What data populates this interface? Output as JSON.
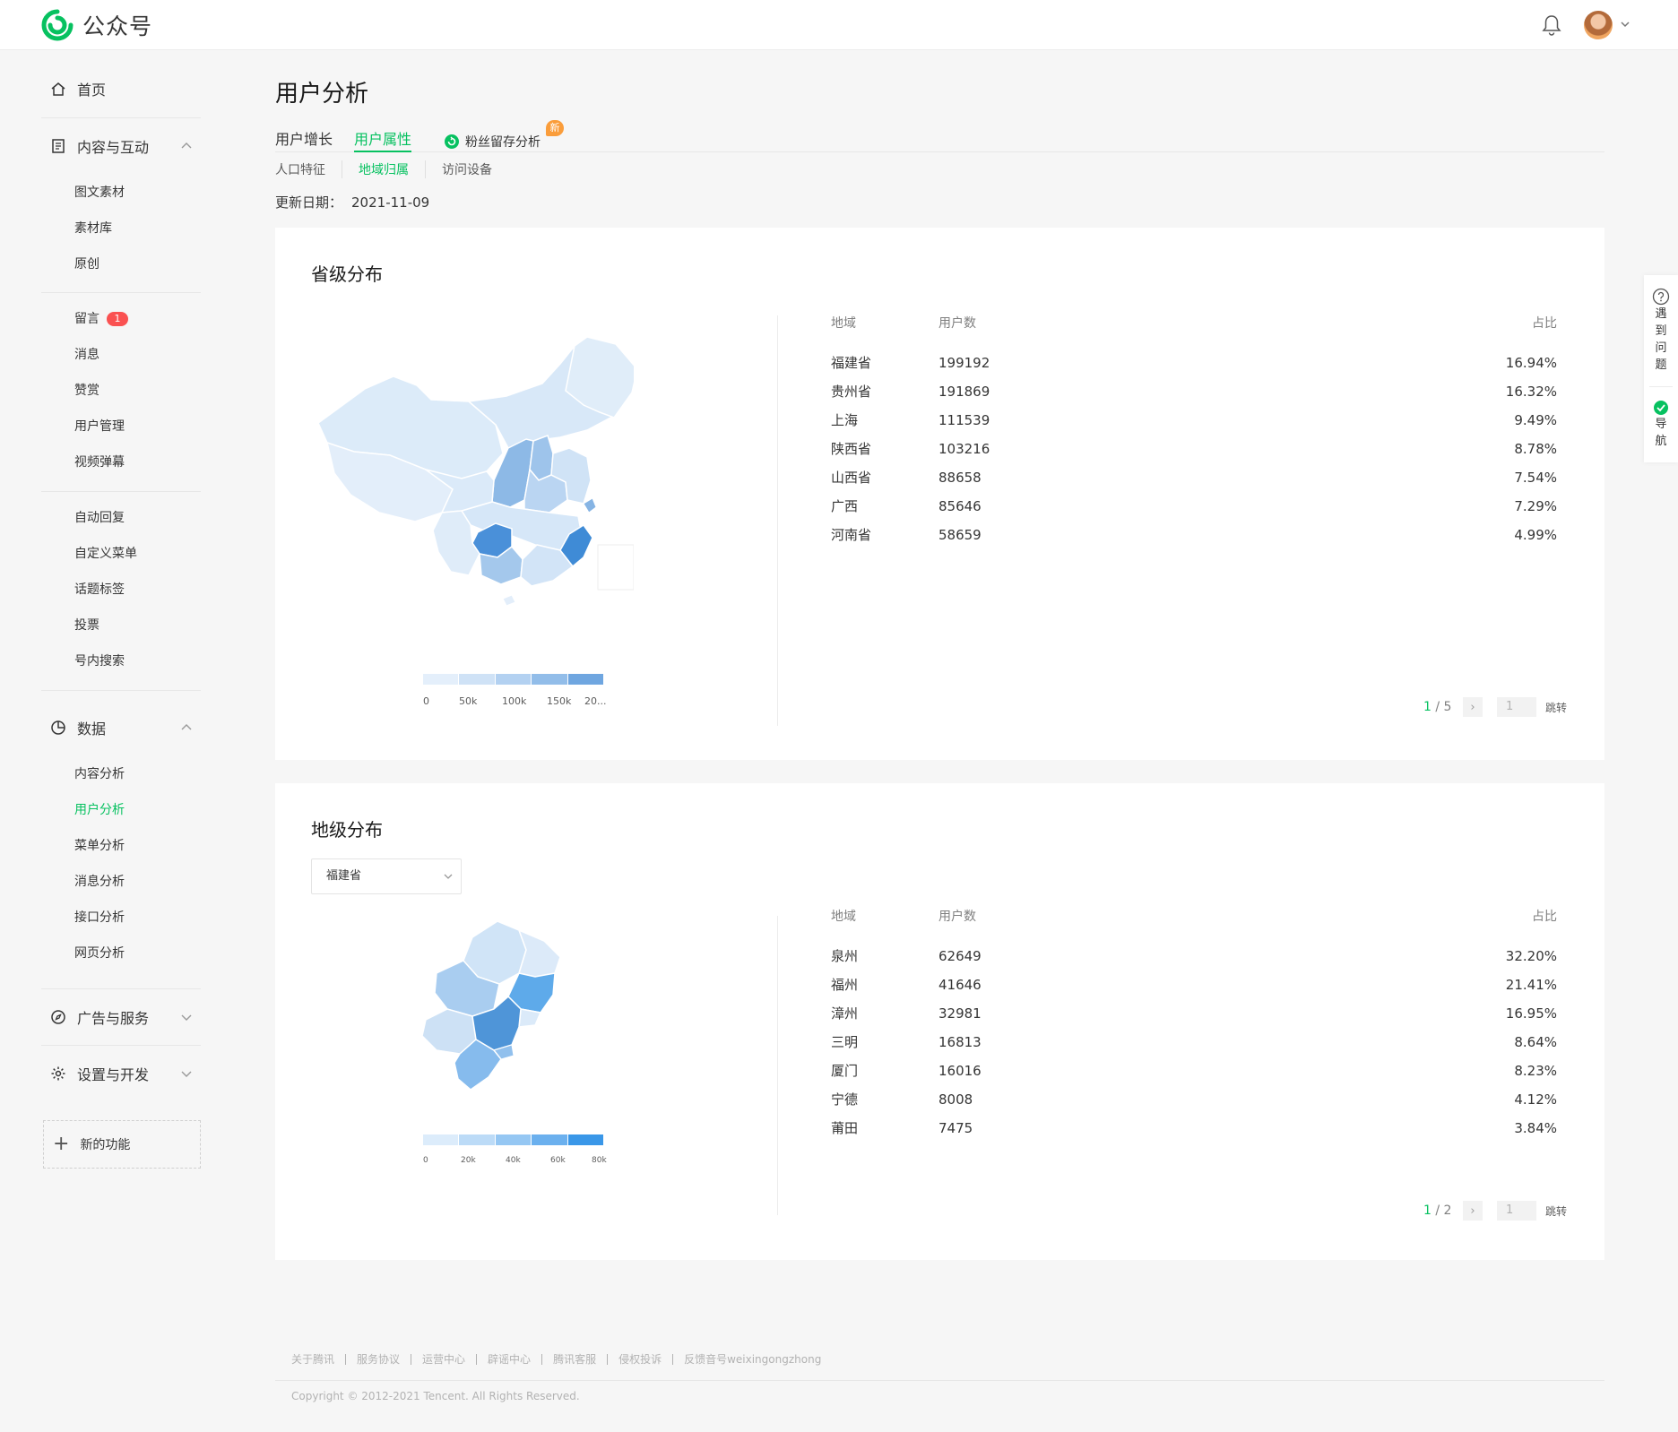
{
  "app": {
    "name": "公众号"
  },
  "sidebar": {
    "home": "首页",
    "content_section": "内容与互动",
    "content_items": [
      "图文素材",
      "素材库",
      "原创"
    ],
    "comment": {
      "label": "留言",
      "badge": "1"
    },
    "interact_items": [
      "消息",
      "赞赏",
      "用户管理",
      "视频弹幕"
    ],
    "func_items": [
      "自动回复",
      "自定义菜单",
      "话题标签",
      "投票",
      "号内搜索"
    ],
    "data_section": "数据",
    "data_items": [
      "内容分析",
      "用户分析",
      "菜单分析",
      "消息分析",
      "接口分析",
      "网页分析"
    ],
    "ads": "广告与服务",
    "settings": "设置与开发",
    "new_feature": "新的功能"
  },
  "page": {
    "title": "用户分析",
    "tabs": [
      "用户增长",
      "用户属性",
      "粉丝留存分析"
    ],
    "new_tag": "新",
    "subtabs": [
      "人口特征",
      "地域归属",
      "访问设备"
    ],
    "update_label": "更新日期：",
    "update_date": "2021-11-09"
  },
  "province": {
    "title": "省级分布",
    "scale_labels": [
      "0",
      "50k",
      "100k",
      "150k",
      "20..."
    ],
    "headers": [
      "地域",
      "用户数",
      "占比"
    ],
    "rows": [
      [
        "福建省",
        "199192",
        "16.94%"
      ],
      [
        "贵州省",
        "191869",
        "16.32%"
      ],
      [
        "上海",
        "111539",
        "9.49%"
      ],
      [
        "陕西省",
        "103216",
        "8.78%"
      ],
      [
        "山西省",
        "88658",
        "7.54%"
      ],
      [
        "广西",
        "85646",
        "7.29%"
      ],
      [
        "河南省",
        "58659",
        "4.99%"
      ]
    ],
    "page_current": "1",
    "page_total": "/ 5",
    "page_input": "1",
    "jump": "跳转"
  },
  "city": {
    "title": "地级分布",
    "select_value": "福建省",
    "scale_labels": [
      "0",
      "20k",
      "40k",
      "60k",
      "80k"
    ],
    "headers": [
      "地域",
      "用户数",
      "占比"
    ],
    "rows": [
      [
        "泉州",
        "62649",
        "32.20%"
      ],
      [
        "福州",
        "41646",
        "21.41%"
      ],
      [
        "漳州",
        "32981",
        "16.95%"
      ],
      [
        "三明",
        "16813",
        "8.64%"
      ],
      [
        "厦门",
        "16016",
        "8.23%"
      ],
      [
        "宁德",
        "8008",
        "4.12%"
      ],
      [
        "莆田",
        "7475",
        "3.84%"
      ]
    ],
    "page_current": "1",
    "page_total": "/ 2",
    "page_input": "1",
    "jump": "跳转"
  },
  "float": {
    "help": [
      "遇",
      "到",
      "问",
      "题"
    ],
    "nav": [
      "导",
      "航"
    ]
  },
  "footer": {
    "links": [
      "关于腾讯",
      "服务协议",
      "运营中心",
      "辟谣中心",
      "腾讯客服",
      "侵权投诉",
      "反馈音号weixingongzhong"
    ],
    "copyright": "Copyright © 2012-2021 Tencent. All Rights Reserved."
  },
  "colors": {
    "accent": "#07c160",
    "map_light": "#dcebf9",
    "map_dark": "#4a90d9"
  }
}
